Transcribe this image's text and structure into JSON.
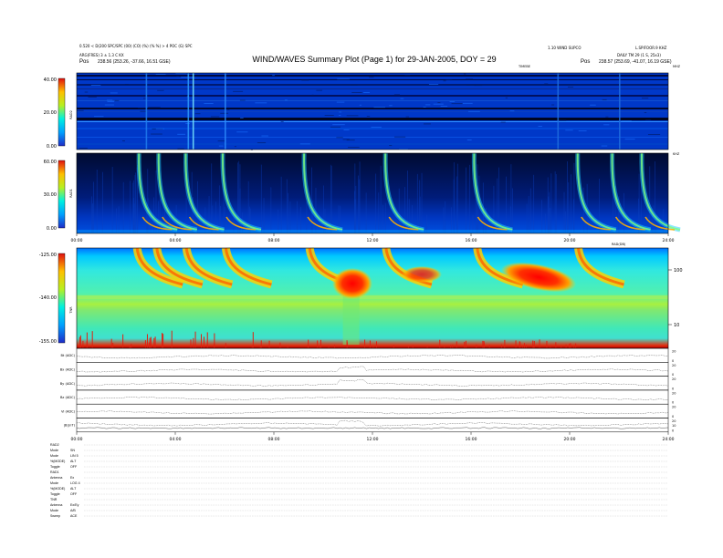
{
  "header": {
    "title": "WIND/WAVES Summary Plot (Page 1) for 29-JAN-2005, DOY = 29",
    "top_left_line1": "0.520 < D(200 SPC/SPC (00) (CO) (%) (% %) > 4 POC (G) SPC",
    "top_left_line2": "ARG(FRES) 3 ± 1.3 C KX",
    "pos_left_label": "Pos",
    "pos_left_value": "238.56 (253.26, -37.66, 16.51 GSE)",
    "top_right_line1": "1.10 WIND SUPCO",
    "top_right_line2": "L.SPIFOOR.9 KHZ",
    "top_right_line3": "DAILY TM 29 (1 S, 25x3)",
    "pos_right_label": "Pos",
    "pos_right_value": "238.57 (253.69, -41.07, 16.19 GSE)"
  },
  "chart_data": [
    {
      "type": "heatmap",
      "name": "RAD2",
      "ylabel": "RAD2",
      "colorbar_ticks": [
        "40.00",
        "20.00",
        "0.00"
      ],
      "top_label": "TIMEBE",
      "right_label": "MHZ"
    },
    {
      "type": "heatmap",
      "name": "RAD1",
      "ylabel": "RAD1",
      "colorbar_ticks": [
        "60.00",
        "30.00",
        "0.00"
      ],
      "xticks": [
        "00:00",
        "04:00",
        "08:00",
        "12:00",
        "16:00",
        "20:00",
        "24:00"
      ],
      "right_label": "KHZ"
    },
    {
      "type": "heatmap",
      "name": "TNR",
      "ylabel": "TNR",
      "colorbar_ticks": [
        "-125.00",
        "-140.00",
        "-155.00"
      ],
      "right_ticks": [
        "100",
        "10"
      ],
      "top_right_label": "RAD(DB)"
    },
    {
      "type": "line",
      "name": "housekeeping",
      "rows": [
        {
          "label": "Bt (ADC)",
          "ticks": [
            "20",
            "0"
          ]
        },
        {
          "label": "Bx (ADC)",
          "ticks": [
            "20",
            "0"
          ]
        },
        {
          "label": "By (ADC)",
          "ticks": [
            "20",
            "0"
          ]
        },
        {
          "label": "Bz (ADC)",
          "ticks": [
            "20",
            "0"
          ]
        },
        {
          "label": "Vi (ADC)",
          "ticks": [
            "20",
            "0"
          ]
        },
        {
          "label": "|B|(nT)",
          "ticks": [
            "20",
            "10",
            "0"
          ]
        }
      ],
      "xticks": [
        "00:00",
        "04:00",
        "08:00",
        "12:00",
        "16:00",
        "20:00",
        "24:00"
      ]
    }
  ],
  "info": {
    "blocks": [
      {
        "header": "RAD2",
        "rows": [
          [
            "Mode",
            "SN"
          ],
          [
            "Mode",
            "LIN 5"
          ],
          [
            "%(MODE)",
            "ALT"
          ],
          [
            "Toggle",
            "OFF"
          ]
        ]
      },
      {
        "header": "RAD1",
        "rows": [
          [
            "Antenna",
            "Ex"
          ],
          [
            "Mode",
            "LOG 4"
          ],
          [
            "%(MODE)",
            "ALT"
          ],
          [
            "Toggle",
            "OFF"
          ]
        ]
      },
      {
        "header": "TNR",
        "rows": [
          [
            "Antenna",
            "Ex/Ey"
          ],
          [
            "Mode",
            "A/B"
          ],
          [
            "Sweep",
            "ACE"
          ]
        ]
      }
    ]
  },
  "colors": {
    "cold": "#0022cc",
    "background": "#003ecc",
    "hot": "#ff1a00"
  }
}
